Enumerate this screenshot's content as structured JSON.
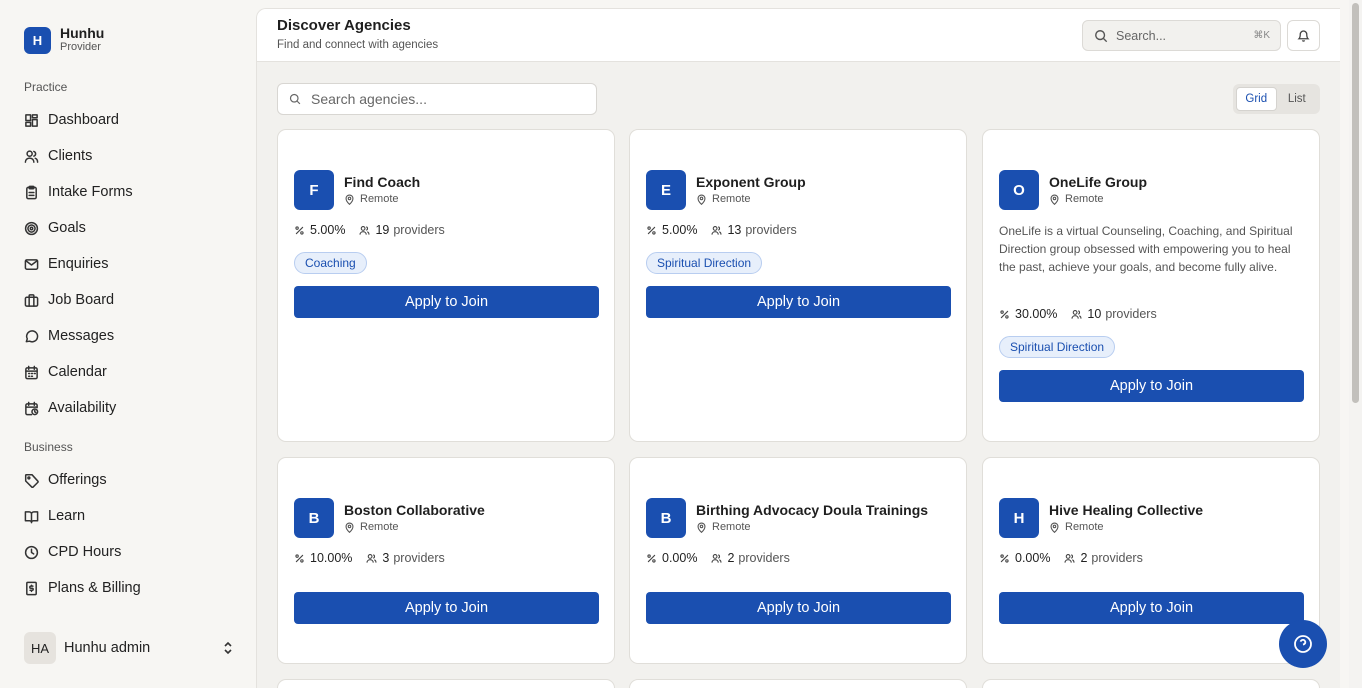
{
  "brand": {
    "logo_letter": "H",
    "name": "Hunhu",
    "role": "Provider"
  },
  "sidebar": {
    "sections": [
      {
        "label": "Practice",
        "items": [
          {
            "label": "Dashboard",
            "icon": "dashboard-icon"
          },
          {
            "label": "Clients",
            "icon": "users-icon"
          },
          {
            "label": "Intake Forms",
            "icon": "clipboard-icon"
          },
          {
            "label": "Goals",
            "icon": "target-icon"
          },
          {
            "label": "Enquiries",
            "icon": "mail-icon"
          },
          {
            "label": "Job Board",
            "icon": "briefcase-icon"
          },
          {
            "label": "Messages",
            "icon": "message-icon"
          },
          {
            "label": "Calendar",
            "icon": "calendar-icon"
          },
          {
            "label": "Availability",
            "icon": "calendar-clock-icon"
          }
        ]
      },
      {
        "label": "Business",
        "items": [
          {
            "label": "Offerings",
            "icon": "tag-icon"
          },
          {
            "label": "Learn",
            "icon": "book-icon"
          },
          {
            "label": "CPD Hours",
            "icon": "clock-icon"
          },
          {
            "label": "Plans & Billing",
            "icon": "receipt-icon"
          }
        ]
      }
    ],
    "user": {
      "initials": "HA",
      "name": "Hunhu admin"
    }
  },
  "header": {
    "title": "Discover Agencies",
    "subtitle": "Find and connect with agencies",
    "search_placeholder": "Search...",
    "search_shortcut": "⌘K"
  },
  "toolbar": {
    "search_placeholder": "Search agencies...",
    "view_grid": "Grid",
    "view_list": "List",
    "active_view": "Grid"
  },
  "agencies": [
    {
      "letter": "F",
      "name": "Find Coach",
      "location": "Remote",
      "commission": "5.00%",
      "providers_count": "19",
      "providers_label": "providers",
      "description": "",
      "tag": "Coaching",
      "cta": "Apply to Join"
    },
    {
      "letter": "E",
      "name": "Exponent Group",
      "location": "Remote",
      "commission": "5.00%",
      "providers_count": "13",
      "providers_label": "providers",
      "description": "",
      "tag": "Spiritual Direction",
      "cta": "Apply to Join"
    },
    {
      "letter": "O",
      "name": "OneLife Group",
      "location": "Remote",
      "commission": "30.00%",
      "providers_count": "10",
      "providers_label": "providers",
      "description": "OneLife is a virtual Counseling, Coaching, and Spiritual Direction group obsessed with empowering you to heal the past, achieve your goals, and become fully alive.",
      "tag": "Spiritual Direction",
      "cta": "Apply to Join"
    },
    {
      "letter": "B",
      "name": "Boston Collaborative",
      "location": "Remote",
      "commission": "10.00%",
      "providers_count": "3",
      "providers_label": "providers",
      "description": "",
      "tag": "",
      "cta": "Apply to Join"
    },
    {
      "letter": "B",
      "name": "Birthing Advocacy Doula Trainings",
      "location": "Remote",
      "commission": "0.00%",
      "providers_count": "2",
      "providers_label": "providers",
      "description": "",
      "tag": "",
      "cta": "Apply to Join"
    },
    {
      "letter": "H",
      "name": "Hive Healing Collective",
      "location": "Remote",
      "commission": "0.00%",
      "providers_count": "2",
      "providers_label": "providers",
      "description": "",
      "tag": "",
      "cta": "Apply to Join"
    }
  ],
  "colors": {
    "accent": "#1a4fb0",
    "tag_bg": "#e7effb",
    "page_bg": "#f2f1ee"
  }
}
